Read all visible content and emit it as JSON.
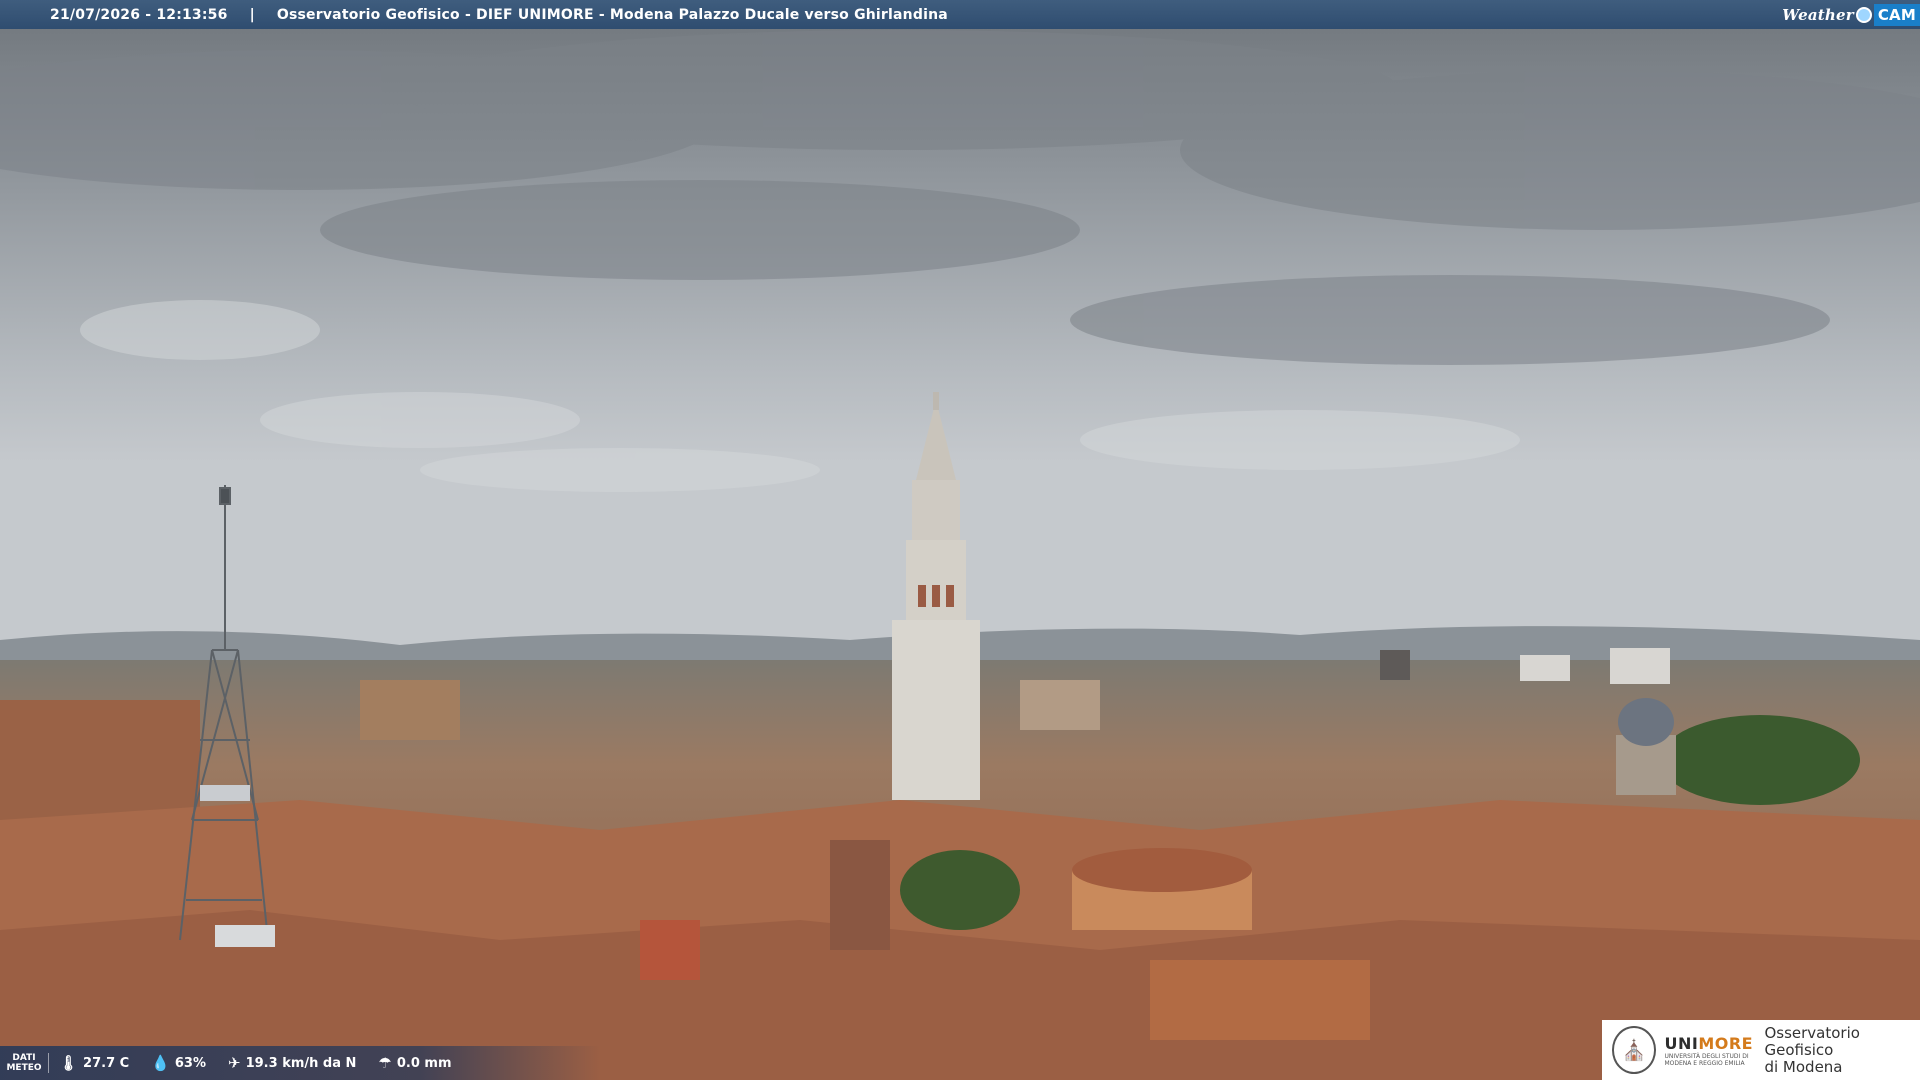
{
  "header": {
    "timestamp": "21/07/2026 - 12:13:56",
    "separator": "|",
    "location": "Osservatorio Geofisico - DIEF UNIMORE - Modena Palazzo Ducale verso Ghirlandina"
  },
  "brand": {
    "weather_text": "Weather",
    "cam_text": "CAM",
    "dot_icon": "camera-lens-icon"
  },
  "meteo": {
    "label": "DATI METEO",
    "temperature": "27.7 C",
    "humidity": "63%",
    "wind": "19.3 km/h da N",
    "rain": "0.0 mm",
    "icons": [
      "thermometer-icon",
      "humidity-drop-icon",
      "wind-icon",
      "rain-icon"
    ]
  },
  "logo": {
    "uni_a": "UNI",
    "uni_b": "MORE",
    "uni_sub": "UNIVERSITÀ DEGLI STUDI DI MODENA E REGGIO EMILIA",
    "observatory_line1": "Osservatorio Geofisico",
    "observatory_line2": "di Modena",
    "accent": "#d47b1c"
  },
  "colors": {
    "topbar": "#35547a",
    "sky": "#aab0b6",
    "roof": "#a8664a"
  }
}
